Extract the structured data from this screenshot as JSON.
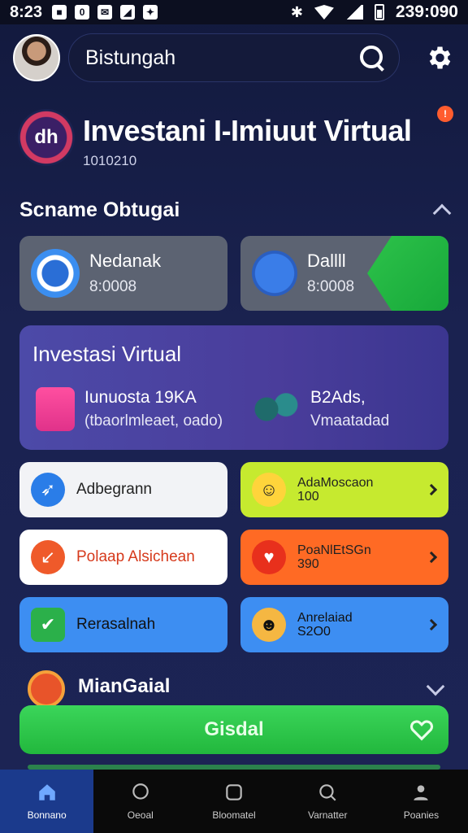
{
  "status_bar": {
    "time": "8:23",
    "clock": "239:090",
    "notif_icons": [
      "■",
      "0",
      "✉",
      "◢",
      "✦"
    ]
  },
  "header": {
    "search_label": "Bistungah"
  },
  "title_block": {
    "logo_text": "dh",
    "title": "Investani I-Imiuut Virtual",
    "subtitle": "1010210",
    "badge": "!"
  },
  "section1": {
    "title": "Scname Obtugai"
  },
  "grey_cards": [
    {
      "title": "Nedanak",
      "value": "8:0008"
    },
    {
      "title": "Dallll",
      "value": "8:0008"
    }
  ],
  "invest": {
    "title": "Investasi Virtual",
    "items": [
      {
        "line1": "Iunuosta 19KA",
        "line2": "(tbaorlmleaet, oado)"
      },
      {
        "line1": "B2Ads,",
        "line2": "Vmaatadad"
      }
    ]
  },
  "tiles": [
    {
      "label": "Adbegrann",
      "bg": "#f2f3f6"
    },
    {
      "label1": "AdaMoscaon",
      "label2": "100",
      "bg": "#c6ea2f"
    },
    {
      "label": "Polaap Alsichean",
      "bg": "#ffffff"
    },
    {
      "label1": "PoaNlEtSGn",
      "label2": "390",
      "bg": "#ff6a24"
    },
    {
      "label": "Rerasalnah",
      "bg": "#3d8ef2"
    },
    {
      "label1": "Anrelaiad",
      "label2": "S2O0",
      "bg": "#3d8ef2"
    }
  ],
  "mian": {
    "title": "MianGaial"
  },
  "main_button": {
    "label": "Gisdal"
  },
  "nav": [
    {
      "label": "Bonnano"
    },
    {
      "label": "Oeoal"
    },
    {
      "label": "Bloomatel"
    },
    {
      "label": "Varnatter"
    },
    {
      "label": "Poanies"
    }
  ]
}
